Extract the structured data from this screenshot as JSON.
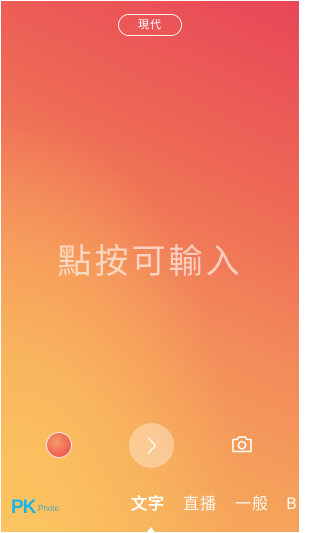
{
  "header": {
    "style_button_label": "現代"
  },
  "canvas": {
    "placeholder": "點按可輸入"
  },
  "controls": {
    "color_button_icon": "color-swatch-icon",
    "next_button_icon": "chevron-right-icon",
    "camera_button_icon": "camera-icon"
  },
  "modes": {
    "items": [
      {
        "label": "文字",
        "active": true
      },
      {
        "label": "直播",
        "active": false
      },
      {
        "label": "一般",
        "active": false
      },
      {
        "label": "B",
        "active": false
      }
    ]
  },
  "watermark": {
    "logo": "PK",
    "text": "Photo"
  },
  "colors": {
    "gradient_top_right": "#e84658",
    "gradient_bottom_left": "#f7b35c",
    "watermark": "#19b4e8"
  }
}
